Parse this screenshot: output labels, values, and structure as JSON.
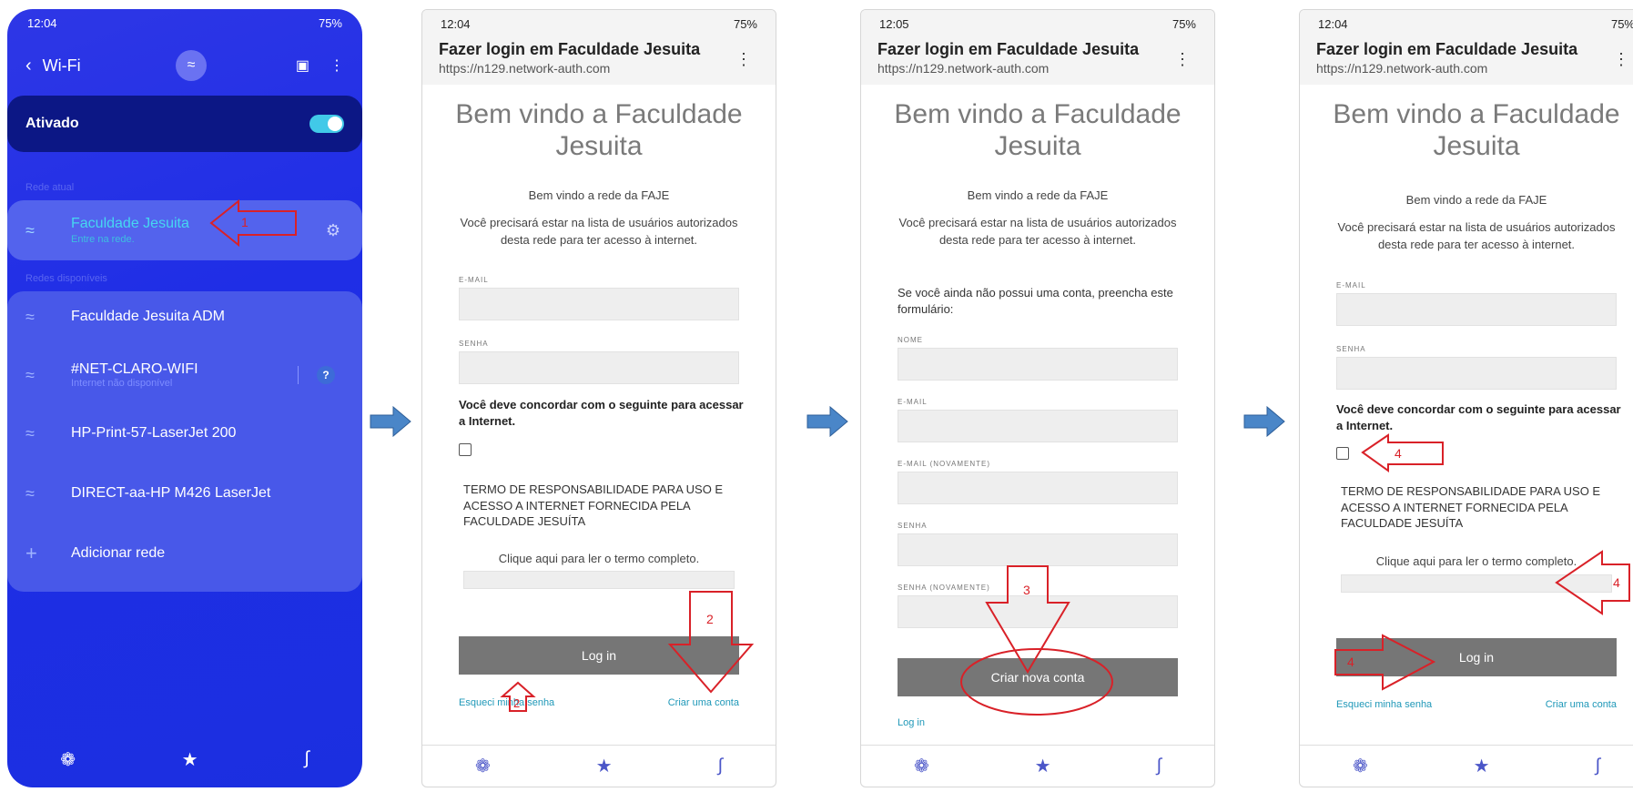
{
  "wifi": {
    "time": "12:04",
    "status_right": "75%",
    "title": "Wi-Fi",
    "ativado": "Ativado",
    "rede_atual": "Rede atual",
    "redes_disponiveis": "Redes disponíveis",
    "current": {
      "name": "Faculdade Jesuita",
      "sub": "Entre na rede."
    },
    "networks": [
      {
        "name": "Faculdade Jesuita ADM",
        "sub": ""
      },
      {
        "name": "#NET-CLARO-WIFI",
        "sub": "Internet não disponível"
      },
      {
        "name": "HP-Print-57-LaserJet 200",
        "sub": ""
      },
      {
        "name": "DIRECT-aa-HP M426 LaserJet",
        "sub": ""
      }
    ],
    "add": "Adicionar rede"
  },
  "login": {
    "title": "Fazer login em Faculdade Jesuita",
    "url": "https://n129.network-auth.com",
    "welcome": "Bem vindo a Faculdade Jesuita",
    "rede": "Bem vindo a rede da FAJE",
    "msg": "Você precisará estar na lista de usuários autorizados desta rede para ter acesso à internet.",
    "email": "E-MAIL",
    "senha": "SENHA",
    "agree": "Você deve concordar com o seguinte para acessar a Internet.",
    "termo": "TERMO DE RESPONSABILIDADE PARA USO E ACESSO A INTERNET FORNECIDA PELA FACULDADE JESUÍTA",
    "clique": "Clique aqui para ler o termo completo.",
    "login_btn": "Log in",
    "forgot": "Esqueci minha senha",
    "create": "Criar uma conta"
  },
  "p2": {
    "time": "12:04",
    "battery": "75%"
  },
  "p3": {
    "time": "12:05",
    "battery": "75%",
    "form_msg": "Se você ainda não possui uma conta, preencha este formulário:",
    "nome": "NOME",
    "email": "E-MAIL",
    "email2": "E-MAIL (NOVAMENTE)",
    "senha": "SENHA",
    "senha2": "SENHA (NOVAMENTE)",
    "create_btn": "Criar nova conta",
    "login_link": "Log in"
  },
  "p4": {
    "time": "12:04",
    "battery": "75%"
  },
  "annotations": {
    "a1": "1",
    "a2": "2",
    "a2b": "2",
    "a3": "3",
    "a4a": "4",
    "a4b": "4",
    "a4c": "4"
  },
  "colors": {
    "annotation": "#d92128",
    "flow_arrow": "#4a86c8"
  }
}
